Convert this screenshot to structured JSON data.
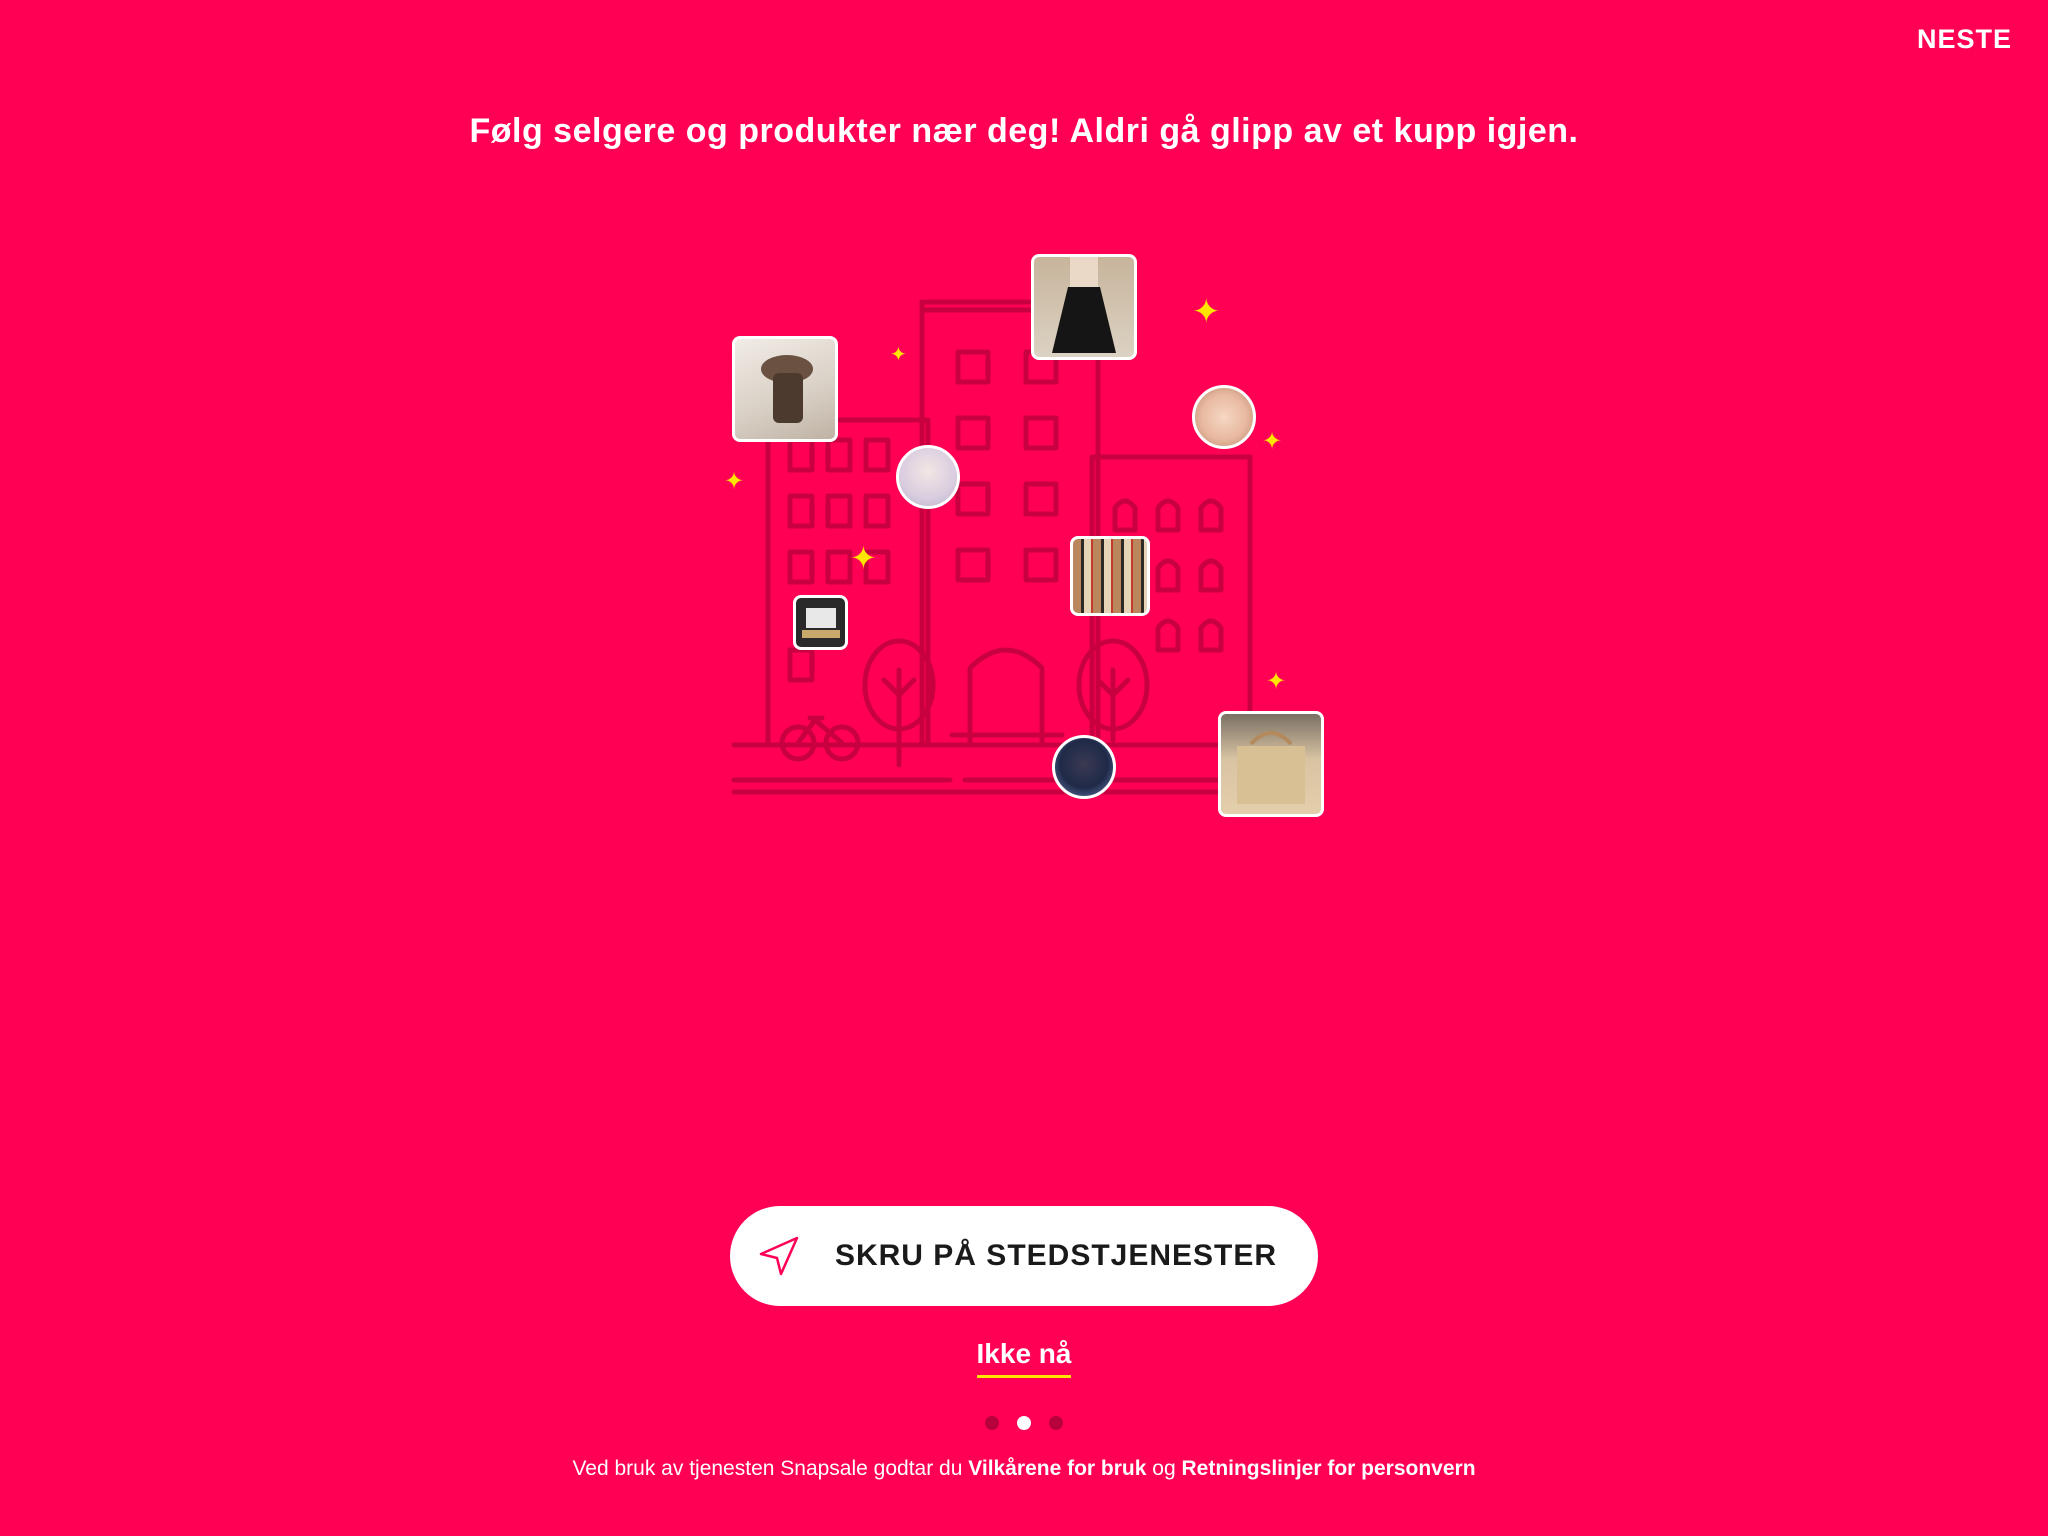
{
  "header": {
    "next_label": "NESTE"
  },
  "headline": "Følg selgere og produkter nær deg! Aldri gå glipp av et kupp igjen.",
  "illustration": {
    "images": [
      {
        "name": "product-thumb-hat",
        "kind": "product"
      },
      {
        "name": "product-thumb-dress",
        "kind": "product"
      },
      {
        "name": "product-thumb-laptop",
        "kind": "product"
      },
      {
        "name": "product-thumb-scarf",
        "kind": "product"
      },
      {
        "name": "product-thumb-bag",
        "kind": "product"
      },
      {
        "name": "seller-avatar-1",
        "kind": "avatar"
      },
      {
        "name": "seller-avatar-2",
        "kind": "avatar"
      },
      {
        "name": "seller-avatar-3",
        "kind": "avatar"
      }
    ],
    "sparkle_color": "#FFE500"
  },
  "cta": {
    "label": "SKRU PÅ STEDSTJENESTER",
    "icon": "location-arrow-icon"
  },
  "secondary": {
    "label": "Ikke nå"
  },
  "pagination": {
    "total": 3,
    "current": 2
  },
  "footer": {
    "text_before": "Ved bruk av tjenesten Snapsale godtar du",
    "terms_link": "Vilkårene for bruk",
    "text_middle": "og",
    "privacy_link": "Retningslinjer for personvern"
  },
  "colors": {
    "background": "#FF0055",
    "accent": "#FFE500",
    "line": "#C8003F"
  }
}
